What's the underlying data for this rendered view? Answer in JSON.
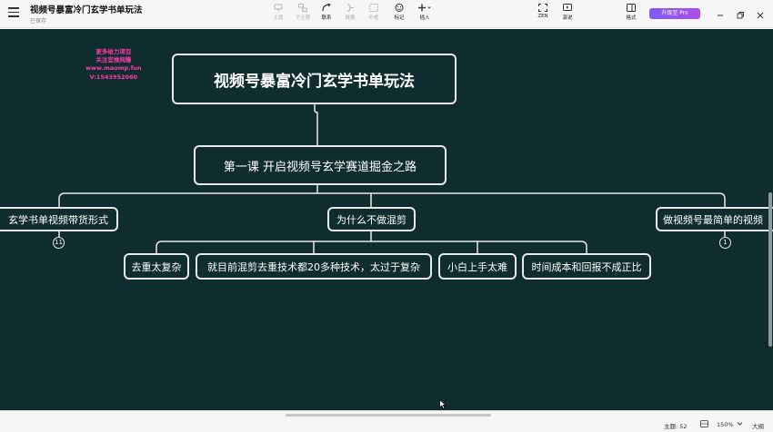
{
  "window": {
    "title": "视频号暴富冷门玄学书单玩法",
    "save_status": "已保存"
  },
  "toolbar": {
    "items": [
      {
        "label": "主题",
        "icon": "topic-icon",
        "enabled": false
      },
      {
        "label": "子主题",
        "icon": "subtopic-icon",
        "enabled": false
      },
      {
        "label": "联系",
        "icon": "relationship-icon",
        "enabled": true
      },
      {
        "label": "概要",
        "icon": "summary-icon",
        "enabled": false
      },
      {
        "label": "外框",
        "icon": "boundary-icon",
        "enabled": false
      },
      {
        "label": "标记",
        "icon": "marker-icon",
        "enabled": true
      },
      {
        "label": "插入",
        "icon": "insert-plus-icon",
        "enabled": true
      }
    ],
    "zen_label": "ZEN",
    "present_label": "演说",
    "format_label": "格式",
    "pro_label": "升级至 Pro"
  },
  "mindmap": {
    "watermark": [
      "更多给力项目",
      "关注官推网赚",
      "www.maomp.fun",
      "V:1543952060"
    ],
    "root": "视频号暴富冷门玄学书单玩法",
    "lesson": "第一课 开启视频号玄学赛道掘金之路",
    "branches": {
      "left": "玄学书单视频带货形式",
      "middle": "为什么不做混剪",
      "right": "做视频号最简单的视频"
    },
    "left_badge": "11",
    "right_badge": "1",
    "reasons": [
      "去重太复杂",
      "就目前混剪去重技术都20多种技术，太过于复杂",
      "小白上手太难",
      "时间成本和回报不成正比"
    ]
  },
  "statusbar": {
    "topic_count": "主题: 52",
    "zoom": "150%",
    "outline_label": "大纲"
  },
  "colors": {
    "canvas_bg": "#0f2c2f",
    "node_border": "#e9e9e9",
    "watermark": "#ff3aa8",
    "pro_gradient_start": "#7b5cf5",
    "pro_gradient_end": "#b04ee8"
  }
}
